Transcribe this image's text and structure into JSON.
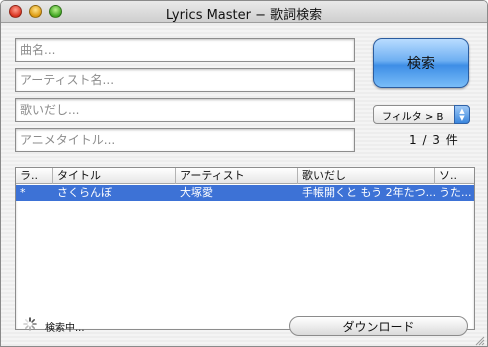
{
  "window": {
    "title": "Lyrics Master − 歌詞検索"
  },
  "form": {
    "song_title_placeholder": "曲名...",
    "artist_placeholder": "アーティスト名...",
    "lyrics_start_placeholder": "歌いだし...",
    "anime_title_placeholder": "アニメタイトル..."
  },
  "search_button_label": "検索",
  "filter": {
    "selected": "フィルタ > B"
  },
  "page_count": "1 / 3 件",
  "table": {
    "columns": [
      "ラ..",
      "タイトル",
      "アーティスト",
      "歌いだし",
      "ソ.."
    ],
    "rows": [
      {
        "marker": "*",
        "title": "さくらんぼ",
        "artist": "大塚愛",
        "lyrics_start": "手帳開くと もう 2年たつ...",
        "source": "うた..."
      }
    ]
  },
  "status_text": "検索中...",
  "download_button_label": "ダウンロード",
  "colors": {
    "accent": "#3d72d6",
    "button_blue": "#6fb0f2"
  }
}
